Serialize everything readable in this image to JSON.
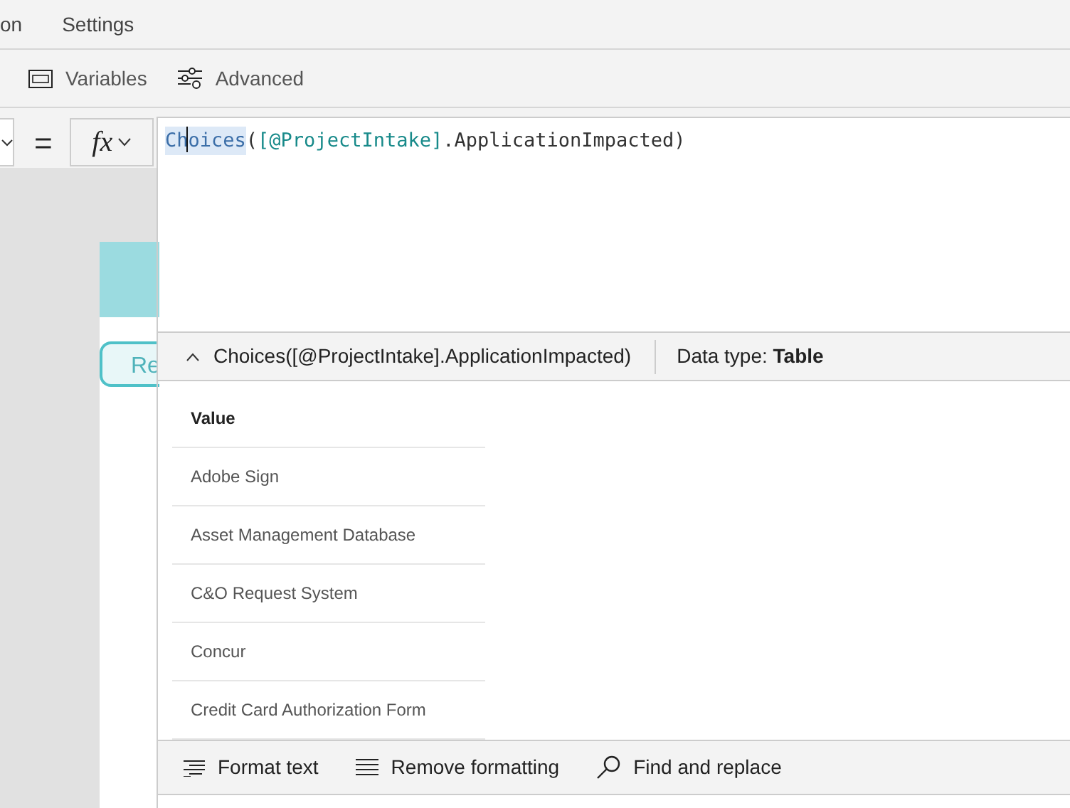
{
  "menu": [
    {
      "label": "on"
    },
    {
      "label": "Settings"
    }
  ],
  "toolbar": [
    {
      "label": "Variables",
      "kind": "variables"
    },
    {
      "label": "Advanced",
      "kind": "advanced"
    }
  ],
  "formula_bar": {
    "equals": "=",
    "fx": "fx",
    "tokens": [
      {
        "text": "Ch",
        "kind": "function",
        "highlighted": true,
        "cursor_after": true
      },
      {
        "text": "oices",
        "kind": "function",
        "highlighted": true,
        "cursor_after": false
      },
      {
        "text": "(",
        "kind": "plain",
        "highlighted": false,
        "cursor_after": false
      },
      {
        "text": "[@ProjectIntake]",
        "kind": "source",
        "highlighted": false,
        "cursor_after": false
      },
      {
        "text": ".ApplicationImpacted)",
        "kind": "plain",
        "highlighted": false,
        "cursor_after": false
      }
    ]
  },
  "canvas": {
    "tab_label": "Re"
  },
  "result": {
    "expression": "Choices([@ProjectIntake].ApplicationImpacted)",
    "expanded": true,
    "data_type_label": "Data type:",
    "data_type": "Table",
    "column": "Value",
    "rows": [
      "Adobe Sign",
      "Asset Management Database",
      "C&O Request System",
      "Concur",
      "Credit Card Authorization Form"
    ]
  },
  "actions": [
    {
      "label": "Format text",
      "kind": "format"
    },
    {
      "label": "Remove formatting",
      "kind": "remove"
    },
    {
      "label": "Find and replace",
      "kind": "find"
    }
  ]
}
